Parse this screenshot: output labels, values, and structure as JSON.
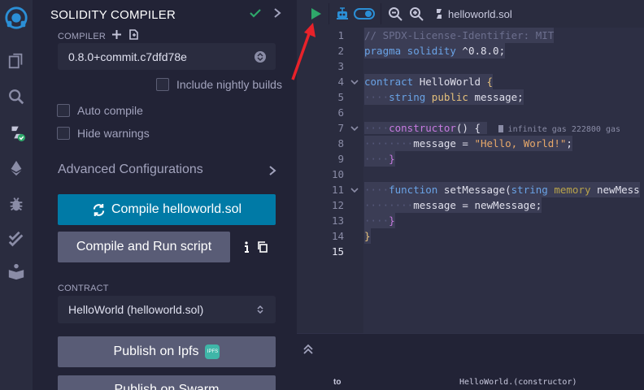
{
  "icons": {
    "rail": [
      "remix-logo-icon",
      "file-explorer-icon",
      "search-icon",
      "solidity-compiler-icon",
      "deploy-run-icon",
      "debugger-icon",
      "testing-icon",
      "learneth-icon"
    ],
    "accent": "#007aa6",
    "check_color": "#2ea86a",
    "run_color": "#2ea86a"
  },
  "panel": {
    "title": "SOLIDITY COMPILER",
    "compiler_label": "COMPILER",
    "compiler_version": "0.8.0+commit.c7dfd78e",
    "include_nightly": "Include nightly builds",
    "auto_compile": "Auto compile",
    "hide_warnings": "Hide warnings",
    "advanced": "Advanced Configurations",
    "compile_button": "Compile helloworld.sol",
    "compile_run_button": "Compile and Run script",
    "contract_label": "CONTRACT",
    "contract_selected": "HelloWorld (helloworld.sol)",
    "publish_ipfs": "Publish on Ipfs",
    "ipfs_badge": "IPFS",
    "publish_swarm": "Publish on Swarm"
  },
  "editor": {
    "file_name": "helloworld.sol",
    "gas_hint": "infinite gas 222800 gas",
    "line_numbers": [
      "1",
      "2",
      "3",
      "4",
      "5",
      "6",
      "7",
      "8",
      "9",
      "10",
      "11",
      "12",
      "13",
      "14",
      "15"
    ],
    "lines": {
      "l1": "// SPDX-License-Identifier: MIT",
      "l2_kw": "pragma solidity",
      "l2_ver": " ^0.8.0;",
      "l4_kw": "contract",
      "l4_name": " HelloWorld ",
      "l4_brace": "{",
      "l5_type": "string",
      "l5_vis": " public",
      "l5_var": " message;",
      "l7_kw": "constructor",
      "l7_rest": "() {",
      "l8_var": "message = ",
      "l8_str": "\"Hello, World!\"",
      "l8_end": ";",
      "l9": "}",
      "l11_kw": "function",
      "l11_name": " setMessage(",
      "l11_type": "string",
      "l11_mem": " memory",
      "l11_param": " newMess",
      "l12": "message = newMessage;",
      "l13": "}",
      "l14": "}"
    }
  },
  "terminal": {
    "to_label": "to",
    "to_value": "HelloWorld.(constructor)"
  }
}
